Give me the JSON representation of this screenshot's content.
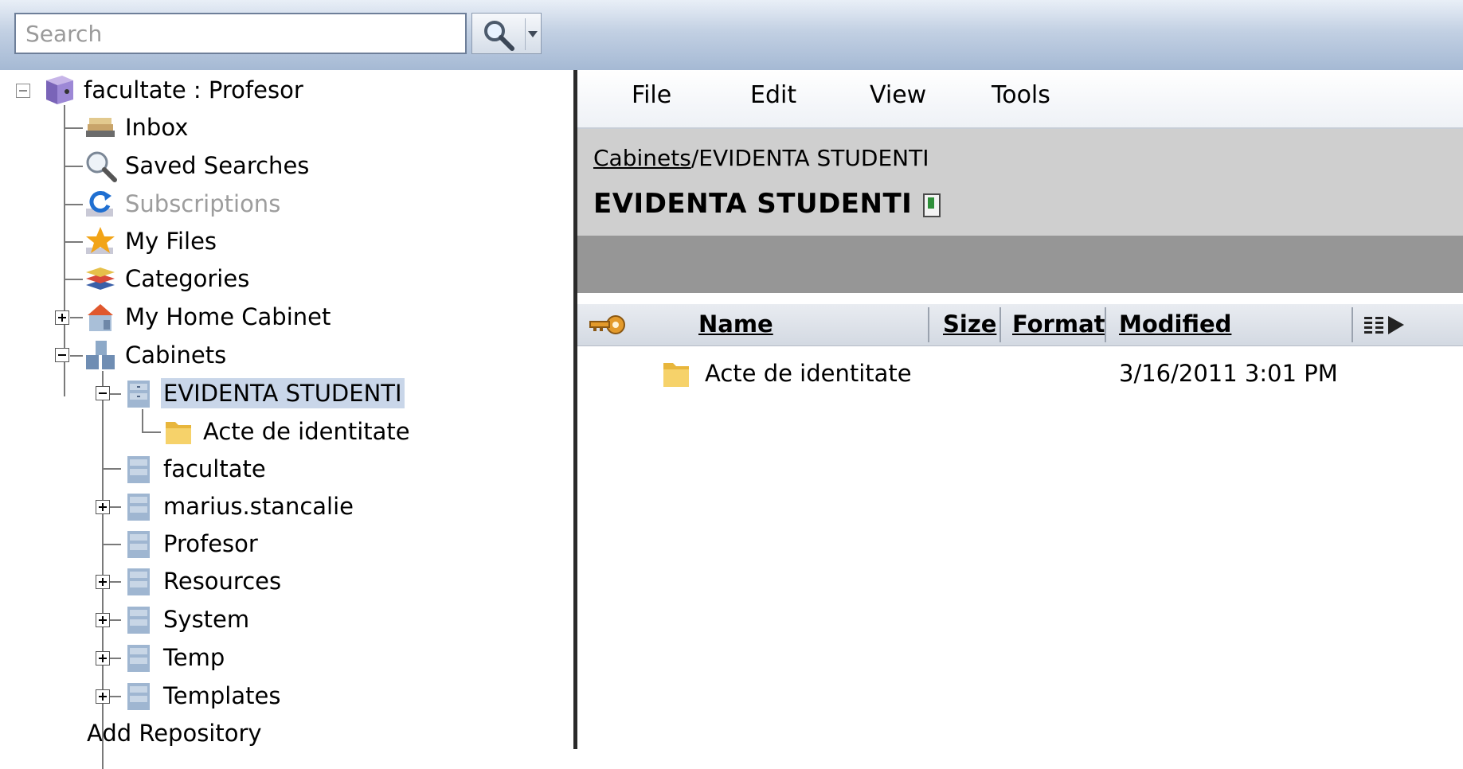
{
  "search": {
    "placeholder": "Search"
  },
  "tree": {
    "root_label": "facultate : Profesor",
    "items": [
      {
        "label": "Inbox"
      },
      {
        "label": "Saved Searches"
      },
      {
        "label": "Subscriptions"
      },
      {
        "label": "My Files"
      },
      {
        "label": "Categories"
      },
      {
        "label": "My Home Cabinet"
      },
      {
        "label": "Cabinets"
      }
    ],
    "cabinets": [
      {
        "label": "EVIDENTA STUDENTI"
      },
      {
        "label": "facultate"
      },
      {
        "label": "marius.stancalie"
      },
      {
        "label": "Profesor"
      },
      {
        "label": "Resources"
      },
      {
        "label": "System"
      },
      {
        "label": "Temp"
      },
      {
        "label": "Templates"
      }
    ],
    "subfolder_label": "Acte de identitate",
    "add_repository": "Add Repository"
  },
  "menu": {
    "file": "File",
    "edit": "Edit",
    "view": "View",
    "tools": "Tools"
  },
  "breadcrumb": {
    "root": "Cabinets",
    "separator": "/",
    "current": "EVIDENTA STUDENTI"
  },
  "page_title": "EVIDENTA STUDENTI",
  "columns": {
    "name": "Name",
    "size": "Size",
    "format": "Format",
    "modified": "Modified"
  },
  "rows": [
    {
      "name": "Acte de identitate",
      "size": "",
      "format": "",
      "modified": "3/16/2011 3:01 PM"
    }
  ],
  "colors": {
    "selection": "#c9d6e9",
    "disabled_text": "#9d9d9d",
    "splitter": "#2a2a2a"
  }
}
